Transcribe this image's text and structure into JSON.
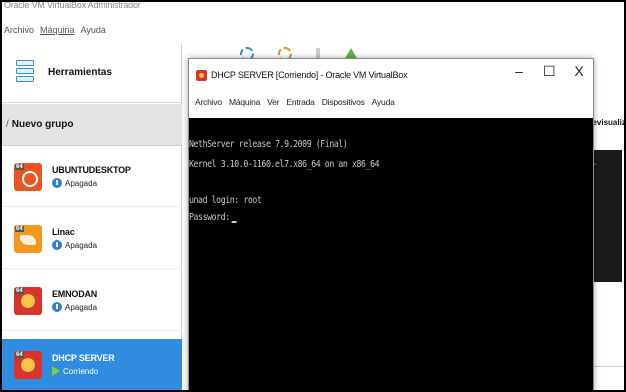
{
  "manager": {
    "title": "Oracle VM VirtualBox Administrador",
    "menu": [
      "Archivo",
      "Máquina",
      "Ayuda"
    ],
    "tools_label": "Herramientas",
    "group_label": "Nuevo grupo",
    "vms": [
      {
        "name": "UBUNTUDESKTOP",
        "status": "Apagada",
        "logo": "ubuntu-logo-icon"
      },
      {
        "name": "Linac",
        "status": "Apagada",
        "logo": "linux-logo-icon"
      },
      {
        "name": "EMNODAN",
        "status": "Apagada",
        "logo": "os-logo-icon"
      },
      {
        "name": "DHCP SERVER",
        "status": "Corriendo",
        "logo": "os-logo-icon",
        "selected": true
      }
    ],
    "preview_label": "Previsualización"
  },
  "vm_window": {
    "title": "DHCP SERVER [Corriendo] - Oracle VM VirtualBox",
    "controls": {
      "minimize": "–",
      "maximize": "☐",
      "close": "X"
    },
    "menu": [
      "Archivo",
      "Máquina",
      "Ver",
      "Entrada",
      "Dispositivos",
      "Ayuda"
    ],
    "console_lines": [
      "NethServer release 7.9.2009 (Final)",
      "Kernel 3.10.0-1160.el7.x86_64 on an x86_64",
      "",
      "unad login: root",
      "Password:"
    ]
  },
  "colors": {
    "selected": "#2f8ce0",
    "console_bg": "#000000",
    "console_fg": "#c8c8c8"
  }
}
